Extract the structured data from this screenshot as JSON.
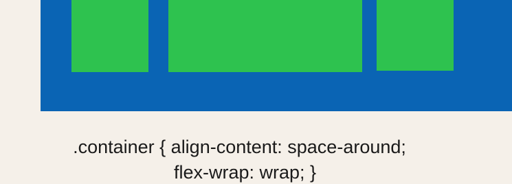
{
  "diagram": {
    "colors": {
      "background": "#f5f0e9",
      "container": "#0a64b4",
      "item": "#2ec24f",
      "text": "#1a1a1a"
    },
    "items": 3
  },
  "caption": {
    "line1": ".container { align-content:  space-around;",
    "line2": "flex-wrap: wrap; }"
  }
}
